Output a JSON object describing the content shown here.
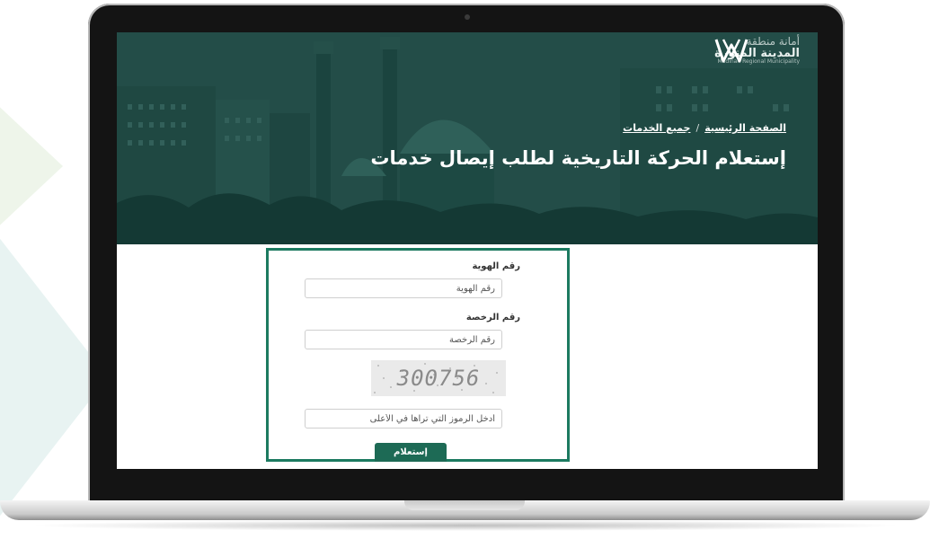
{
  "header": {
    "logo_line1": "أمانة منطقة",
    "logo_line2": "المدينة المنورة",
    "logo_line3": "Madinah Regional Municipality"
  },
  "breadcrumb": {
    "home": "الصفحة الرئيسية",
    "separator": "/",
    "all_services": "جميع الخدمات"
  },
  "page": {
    "title": "إستعلام الحركة التاريخية لطلب إيصال خدمات"
  },
  "form": {
    "id_label": "رقم الهوية",
    "id_placeholder": "رقم الهوية",
    "license_label": "رقم الرخصة",
    "license_placeholder": "رقم الرخصة",
    "captcha_code": "300756",
    "captcha_placeholder": "أدخل الرموز التي تراها في الأعلى",
    "submit_label": "إستعلام"
  },
  "colors": {
    "brand_green": "#1d6a55",
    "form_border": "#1c7a60",
    "hero_overlay": "#1d4942"
  }
}
